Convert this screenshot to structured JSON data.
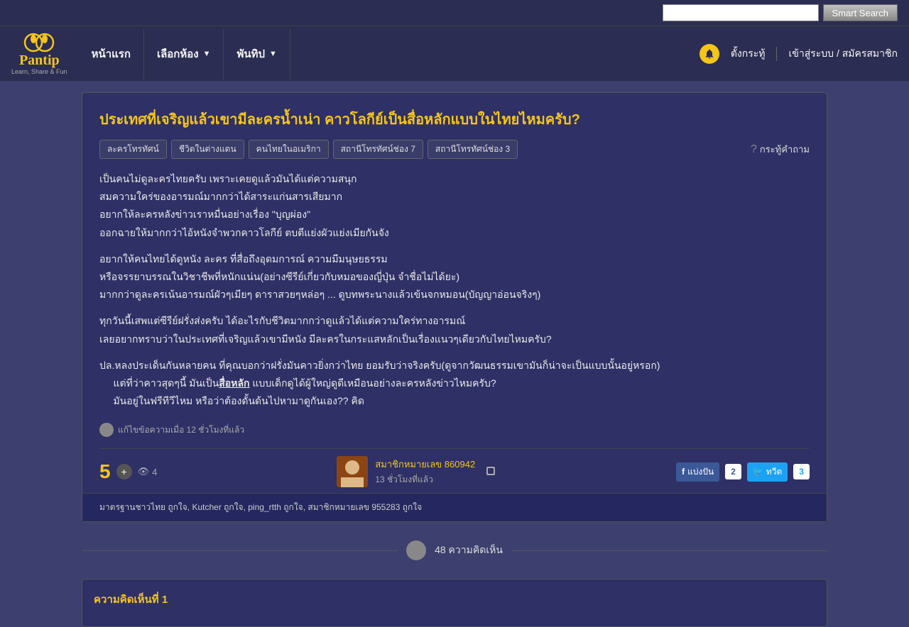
{
  "topbar": {
    "search_placeholder": "",
    "smart_search_label": "Smart Search"
  },
  "nav": {
    "logo_text": "Pantip",
    "logo_tagline": "Learn, Share & Fun",
    "links": [
      {
        "label": "หน้าแรก",
        "has_dropdown": false
      },
      {
        "label": "เลือกห้อง",
        "has_dropdown": true
      },
      {
        "label": "พันทิป",
        "has_dropdown": true
      }
    ],
    "right_links": [
      {
        "label": "ตั้งกระทู้"
      },
      {
        "label": "เข้าสู่ระบบ / สมัครสมาชิก"
      }
    ]
  },
  "question": {
    "title": "ประเทศที่เจริญแล้วเขามีละครน้ำเน่า คาวโลกีย์เป็นสื่อหลักแบบในไทยไหมครับ?",
    "tags": [
      "ละครโทรทัศน์",
      "ชีวิตในต่างแดน",
      "คนไทยในอเมริกา",
      "สถานีโทรทัศน์ช่อง 7",
      "สถานีโทรทัศน์ช่อง 3"
    ],
    "ask_label": "กระทู้คำถาม",
    "body_paragraphs": [
      "เป็นคนไม่ดูละครไทยครับ เพราะเคยดูแล้วมันได้แต่ความสนุก\nสมความใคร่ของอารมณ์มากกว่าได้สาระแก่นสารเสียมาก\nอยากให้ละครหลังข่าวเราหมื่นอย่างเรื่อง \"บุญผ่อง\"\nออกฉายให้มากกว่าไอ้หนังจำพวกคาวโลกีย์ ตบตีแย่งผัวแย่งเมียกันจัง",
      "อยากให้คนไทยได้ดูหนัง ละคร ที่สื่อถึงอุดมการณ์ ความมีมนุษยธรรม\nหรือจรรยาบรรณในวิชาชีพที่หนักแน่น(อย่างซีรีย์เกี่ยวกับหมอของญี่ปุ่น จำชื่อไม่ได้ยะ)\nมากกว่าดูละครเน้นอารมณ์ผัวๆเมียๆ ดาราสวยๆหล่อๆ ... ดูบทพระนางแล้วเข้นจกหมอน(บัญญาอ่อนจริงๆ)",
      "ทุกวันนี้เสพแต่ซีรีย์ฝรั่งส่งครับ ได้อะไรกับชีวิตมากกว่าดูแล้วได้แต่ความใคร่ทางอารมณ์\nเลยอยากทราบว่าในประเทศที่เจริญแล้วเขามีหนัง มีละครในกระแสหลักเป็นเรื่องแนวๆเดียวกับไทยไหมครับ?"
    ],
    "ps_paragraph": "ปล.หลงประเด็นกันหลายคน ที่คุณบอกว่าฝรั่งมันคาวยิ่งกว่าไทย ยอมรับว่าจริงครับ(ดูจากวัฒนธรรมเขามันก็น่าจะเป็นแบบนั้นอยู่หรอก)\n     แต่ที่ว่าคาวสุดๆนี้ มันเป็น",
    "ps_bold": "สื่อหลัก",
    "ps_after": " แบบเด็กดูได้ผู้ใหญ่ดูดีเหมือนอย่างละครหลังข่าวไหมครับ?\n     มันอยู่ในฟรีทีวีไหม หรือว่าต้องดั้นด้นไปหามาดูกันเอง??  คิด",
    "edit_note": "แก้ไขข้อความเมื่อ 12 ชั่วโมงที่แล้ว",
    "vote_count": "5",
    "eye_count": "4",
    "user": {
      "name": "สมาชิกหมายเลข 860942",
      "time": "13 ชั่วโมงที่แล้ว"
    },
    "share": {
      "fb_label": "แบ่งปัน",
      "fb_count": "2",
      "tw_label": "ทวีต",
      "tw_count": "3"
    },
    "likes_text": "มาตรฐานชาวไทย ถูกใจ, Kutcher ถูกใจ, ping_rtth ถูกใจ, สมาชิกหมายเลข 955283 ถูกใจ"
  },
  "comments": {
    "count": "48",
    "count_label": "48 ความคิดเห็น",
    "first_comment_label": "ความคิดเห็นที่ 1"
  }
}
